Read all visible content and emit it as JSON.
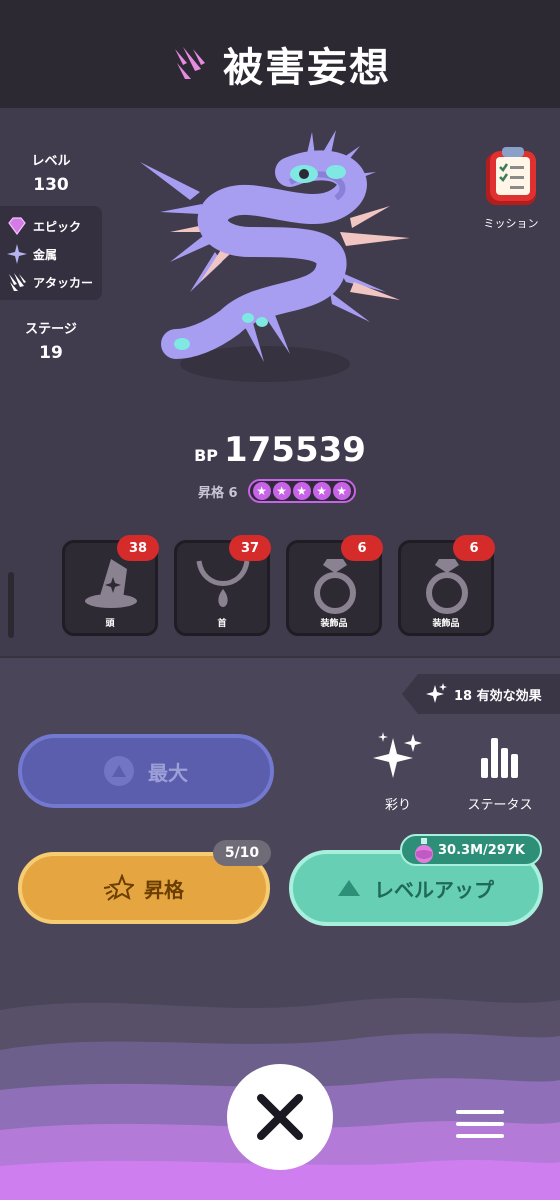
{
  "header": {
    "title": "被害妄想",
    "class_icon": "claw-slash-icon"
  },
  "stats": {
    "level_label": "レベル",
    "level_value": "130",
    "rarity": "エピック",
    "element": "金属",
    "role": "アタッカー",
    "stage_label": "ステージ",
    "stage_value": "19"
  },
  "mission": {
    "label": "ミッション",
    "icon": "clipboard-checklist-icon"
  },
  "power": {
    "bp_label": "BP",
    "bp_value": "175539",
    "ascension_label": "昇格",
    "ascension_value": "6",
    "stars": 5
  },
  "equipment": [
    {
      "slot": "頭",
      "badge": "38",
      "icon": "wizard-hat-icon"
    },
    {
      "slot": "首",
      "badge": "37",
      "icon": "necklace-icon"
    },
    {
      "slot": "装飾品",
      "badge": "6",
      "icon": "ring-icon"
    },
    {
      "slot": "装飾品",
      "badge": "6",
      "icon": "ring-icon"
    }
  ],
  "effects": {
    "label": "18 有効な効果"
  },
  "buttons": {
    "max": "最大",
    "color": "彩り",
    "status": "ステータス",
    "ascend": "昇格",
    "ascend_count": "5/10",
    "level_up": "レベルアップ",
    "level_cost": "30.3M/297K"
  },
  "colors": {
    "header_bg": "#2c2933",
    "accent_purple": "#c763e6",
    "badge_red": "#d62b2b",
    "ascend": "#e5a541",
    "level_up": "#66cfb4"
  }
}
